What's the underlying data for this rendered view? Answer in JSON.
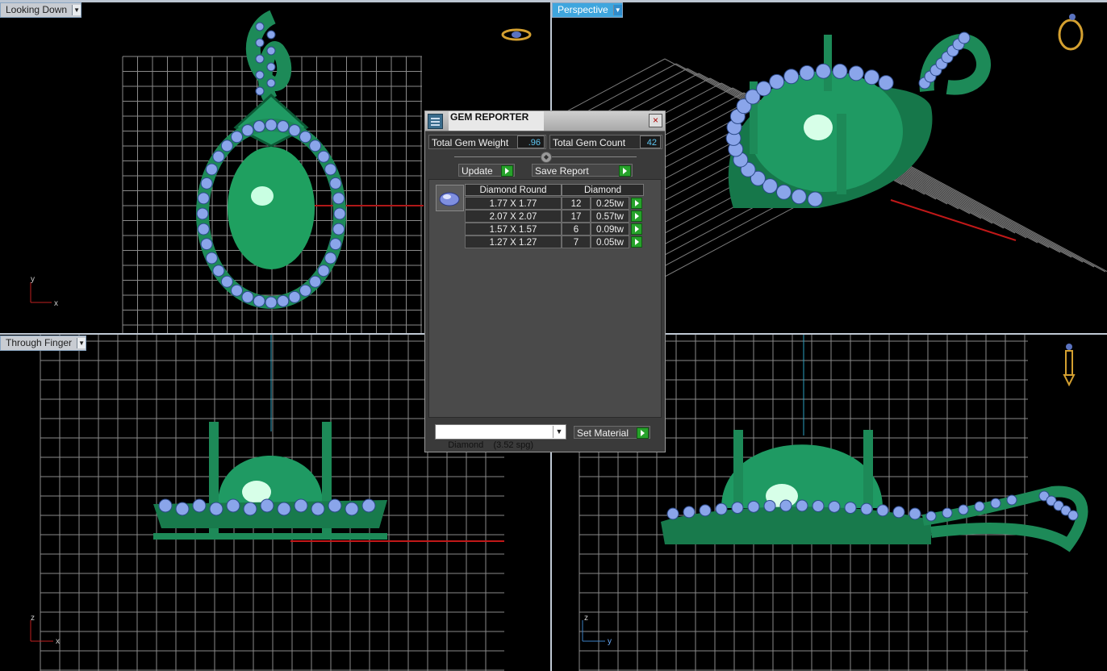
{
  "viewports": {
    "top_left": {
      "label": "Looking Down",
      "axis_v": "y",
      "axis_h": "x"
    },
    "top_right": {
      "label": "Perspective"
    },
    "bottom_left": {
      "label": "Through Finger",
      "axis_v": "z",
      "axis_h": "x"
    },
    "bottom_right": {
      "label": "",
      "axis_v": "z",
      "axis_h": "y"
    }
  },
  "gem_reporter": {
    "title": "GEM REPORTER",
    "close": "×",
    "total_weight_label": "Total Gem Weight",
    "total_weight_value": ".96",
    "total_count_label": "Total Gem Count",
    "total_count_value": "42",
    "update_label": "Update",
    "save_report_label": "Save Report",
    "table": {
      "header_shape": "Diamond Round",
      "header_material": "Diamond",
      "rows": [
        {
          "size": "1.77 X 1.77",
          "count": "12",
          "weight": "0.25tw"
        },
        {
          "size": "2.07 X 2.07",
          "count": "17",
          "weight": "0.57tw"
        },
        {
          "size": "1.57 X 1.57",
          "count": "6",
          "weight": "0.09tw"
        },
        {
          "size": "1.27 X 1.27",
          "count": "7",
          "weight": "0.05tw"
        }
      ]
    },
    "material_select": "Diamond    (3.52 spg)",
    "set_material_label": "Set Material"
  },
  "colors": {
    "metal": "#1f9a63",
    "gem": "#7f9fe6",
    "grid": "#8a8a8a",
    "accent": "#3fa6de"
  }
}
